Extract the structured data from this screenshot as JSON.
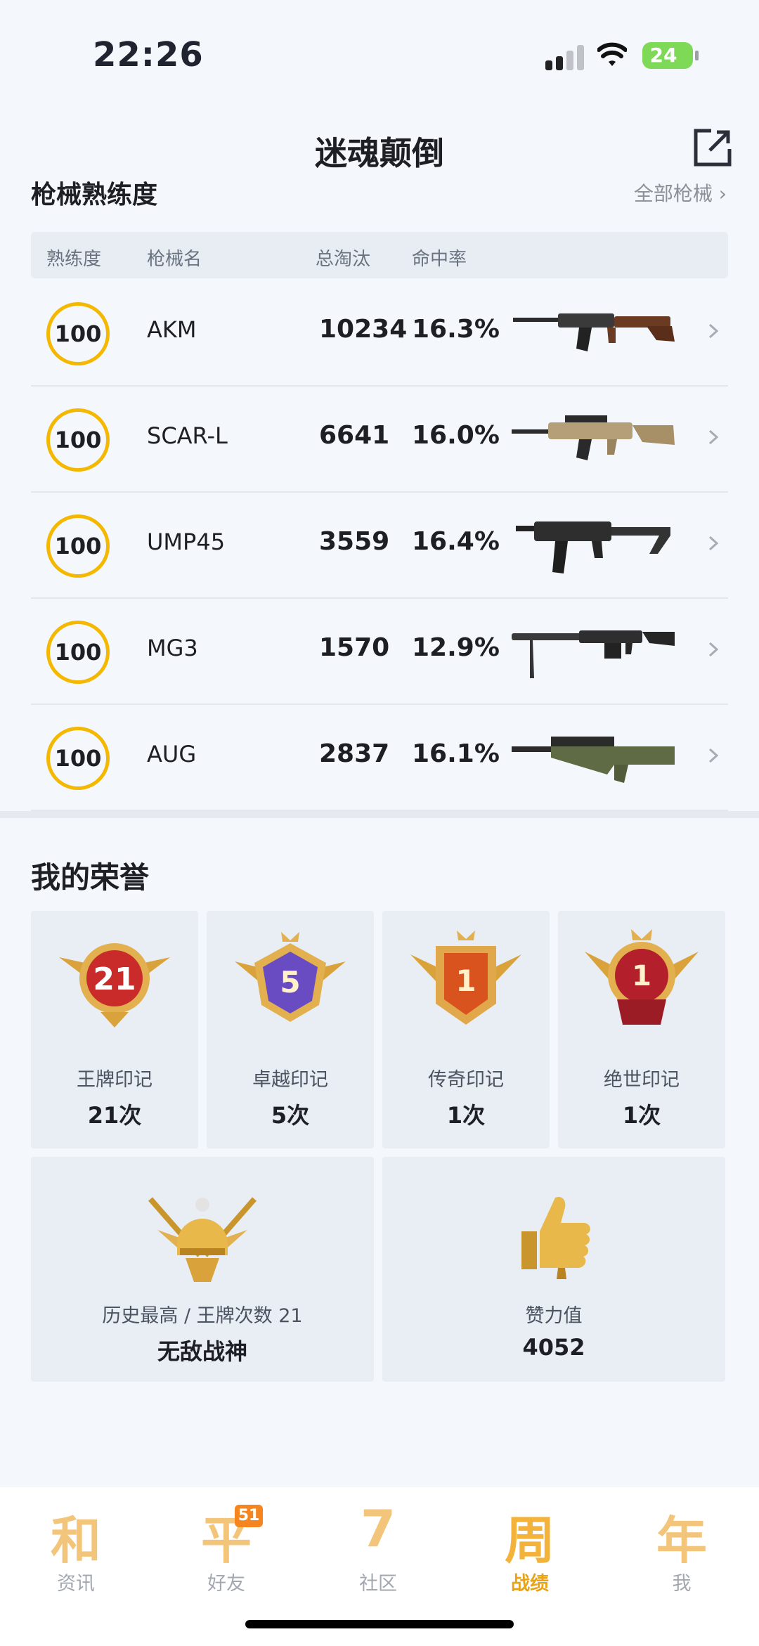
{
  "status_bar": {
    "time": "22:26",
    "battery": "24"
  },
  "header": {
    "title": "迷魂颠倒"
  },
  "weapons_section": {
    "title": "枪械熟练度",
    "all_link": "全部枪械",
    "columns": [
      "熟练度",
      "枪械名",
      "总淘汰",
      "命中率"
    ],
    "rows": [
      {
        "level": "100",
        "name": "AKM",
        "kills": "10234",
        "rate": "16.3%"
      },
      {
        "level": "100",
        "name": "SCAR-L",
        "kills": "6641",
        "rate": "16.0%"
      },
      {
        "level": "100",
        "name": "UMP45",
        "kills": "3559",
        "rate": "16.4%"
      },
      {
        "level": "100",
        "name": "MG3",
        "kills": "1570",
        "rate": "12.9%"
      },
      {
        "level": "100",
        "name": "AUG",
        "kills": "2837",
        "rate": "16.1%"
      }
    ]
  },
  "honors": {
    "title": "我的荣誉",
    "marks": [
      {
        "medal_text": "21",
        "label": "王牌印记",
        "count": "21次",
        "color": "#c92a2a"
      },
      {
        "medal_text": "5",
        "label": "卓越印记",
        "count": "5次",
        "color": "#6a4cc2"
      },
      {
        "medal_text": "1",
        "label": "传奇印记",
        "count": "1次",
        "color": "#d9531e"
      },
      {
        "medal_text": "1",
        "label": "绝世印记",
        "count": "1次",
        "color": "#b3202b"
      }
    ],
    "highest": {
      "label": "历史最高 / 王牌次数 21",
      "value": "无敌战神"
    },
    "likes": {
      "label": "赞力值",
      "value": "4052"
    }
  },
  "tabbar": {
    "tabs": [
      {
        "glyph": "和",
        "label": "资讯"
      },
      {
        "glyph": "平",
        "label": "好友",
        "badge": "51"
      },
      {
        "glyph": "7",
        "label": "社区"
      },
      {
        "glyph": "周",
        "label": "战绩"
      },
      {
        "glyph": "年",
        "label": "我"
      }
    ],
    "active_index": 3
  },
  "colors": {
    "accent": "#f5b800",
    "tab_active": "#e8a416",
    "badge": "#f5861f"
  }
}
